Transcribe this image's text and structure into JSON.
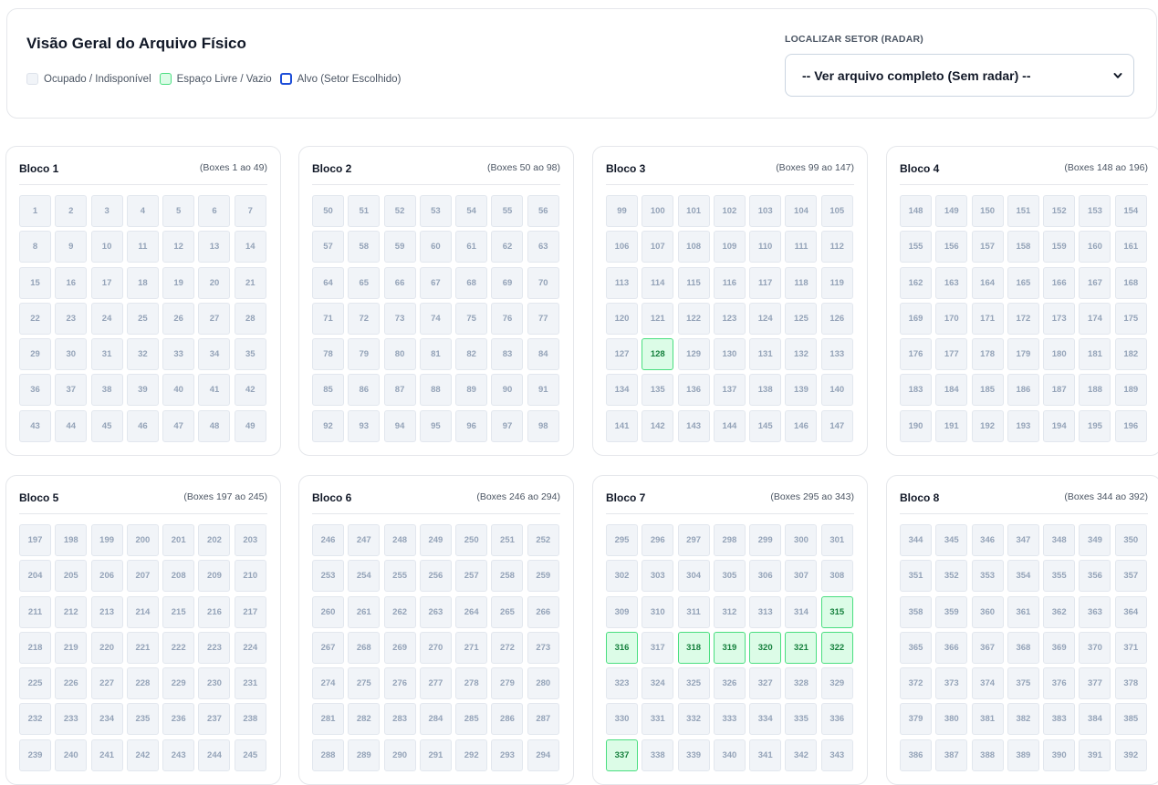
{
  "header": {
    "title": "Visão Geral do Arquivo Físico",
    "legend": {
      "occupied": "Ocupado / Indisponível",
      "free": "Espaço Livre / Vazio",
      "target": "Alvo (Setor Escolhido)"
    },
    "radar_label": "LOCALIZAR SETOR (RADAR)",
    "radar_select_value": "-- Ver arquivo completo (Sem radar) --"
  },
  "colors": {
    "free_bg": "#dcfce7",
    "free_border": "#4ade80",
    "occupied_bg": "#f1f4f8",
    "target_border": "#1d4ed8"
  },
  "blocks": [
    {
      "name": "Bloco 1",
      "range": "(Boxes 1 ao 49)",
      "start": 1,
      "end": 49,
      "free": []
    },
    {
      "name": "Bloco 2",
      "range": "(Boxes 50 ao 98)",
      "start": 50,
      "end": 98,
      "free": []
    },
    {
      "name": "Bloco 3",
      "range": "(Boxes 99 ao 147)",
      "start": 99,
      "end": 147,
      "free": [
        128
      ]
    },
    {
      "name": "Bloco 4",
      "range": "(Boxes 148 ao 196)",
      "start": 148,
      "end": 196,
      "free": []
    },
    {
      "name": "Bloco 5",
      "range": "(Boxes 197 ao 245)",
      "start": 197,
      "end": 245,
      "free": []
    },
    {
      "name": "Bloco 6",
      "range": "(Boxes 246 ao 294)",
      "start": 246,
      "end": 294,
      "free": []
    },
    {
      "name": "Bloco 7",
      "range": "(Boxes 295 ao 343)",
      "start": 295,
      "end": 343,
      "free": [
        315,
        316,
        318,
        319,
        320,
        321,
        322,
        337
      ]
    },
    {
      "name": "Bloco 8",
      "range": "(Boxes 344 ao 392)",
      "start": 344,
      "end": 392,
      "free": []
    }
  ]
}
